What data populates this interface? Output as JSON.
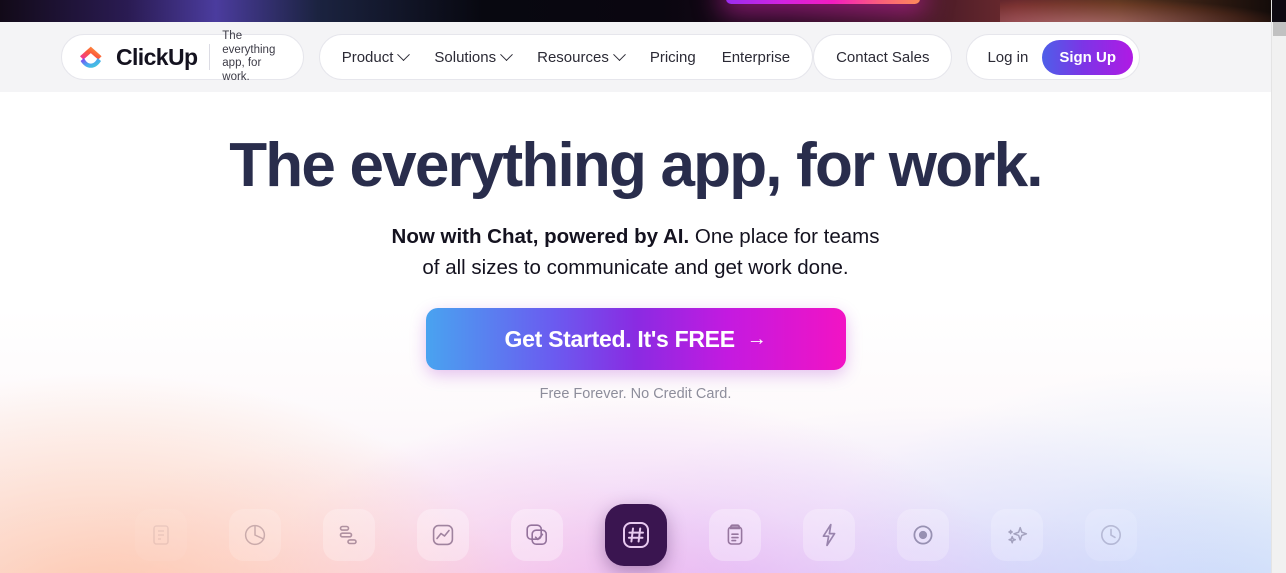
{
  "topbar": {
    "accent_start": "#9b2df0",
    "accent_mid": "#f41cc0",
    "accent_end": "#fb8a5a"
  },
  "header": {
    "logo": {
      "word": "ClickUp",
      "tagline_line1": "The everything",
      "tagline_line2": "app, for work."
    },
    "nav": [
      {
        "label": "Product",
        "has_dropdown": true
      },
      {
        "label": "Solutions",
        "has_dropdown": true
      },
      {
        "label": "Resources",
        "has_dropdown": true
      },
      {
        "label": "Pricing",
        "has_dropdown": false
      },
      {
        "label": "Enterprise",
        "has_dropdown": false
      }
    ],
    "contact_sales": "Contact Sales",
    "login": "Log in",
    "signup": "Sign Up",
    "signup_gradient_start": "#4e5fe8",
    "signup_gradient_end": "#b01ae4"
  },
  "hero": {
    "headline": "The everything app, for work.",
    "sub_bold": "Now with Chat, powered by AI.",
    "sub_rest": " One place for teams",
    "sub_line2": "of all sizes to communicate and get work done.",
    "cta_label": "Get Started. It's FREE",
    "cta_arrow": "→",
    "fineprint": "Free Forever. No Credit Card.",
    "headline_color": "#292d4c",
    "cta_gradient_start": "#49a3f0",
    "cta_gradient_mid": "#8a2be2",
    "cta_gradient_end": "#f213c4"
  },
  "icon_row": {
    "active_index": 5,
    "active_bg": "#3a1550",
    "items": [
      {
        "icon": "docs-icon",
        "opacity_class": "o-05"
      },
      {
        "icon": "pie-chart-icon",
        "opacity_class": "o-1"
      },
      {
        "icon": "gantt-icon",
        "opacity_class": "o-2"
      },
      {
        "icon": "line-chart-icon",
        "opacity_class": "o-3"
      },
      {
        "icon": "tasks-check-icon",
        "opacity_class": "o-4"
      },
      {
        "icon": "chat-hash-icon",
        "opacity_class": ""
      },
      {
        "icon": "clipboard-icon",
        "opacity_class": "o-5"
      },
      {
        "icon": "automation-bolt-icon",
        "opacity_class": "o-6"
      },
      {
        "icon": "record-target-icon",
        "opacity_class": "o-7"
      },
      {
        "icon": "ai-sparkles-icon",
        "opacity_class": "o-8"
      },
      {
        "icon": "time-clock-icon",
        "opacity_class": "o-9"
      }
    ]
  },
  "scrollbar": {
    "visible": true
  }
}
